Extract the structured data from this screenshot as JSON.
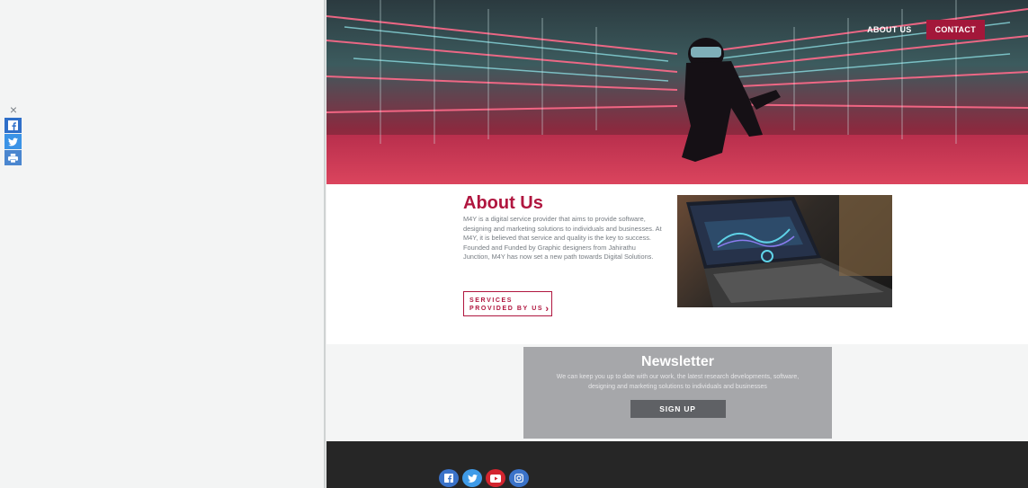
{
  "share_bar": {
    "close_glyph": "×",
    "icons": [
      "facebook-icon",
      "twitter-icon",
      "print-icon"
    ]
  },
  "nav": {
    "about_label": "ABOUT US",
    "contact_label": "CONTACT"
  },
  "about": {
    "title": "About Us",
    "text": "M4Y is a digital service provider that aims to provide software, designing and marketing solutions to individuals and businesses. At M4Y, it is believed that service and quality is the key to success. Founded and Funded by Graphic designers from Jahirathu Junction, M4Y has now set a new path towards Digital Solutions.",
    "services_line1": "SERVICES",
    "services_line2": "PROVIDED BY US",
    "services_arrow": "›"
  },
  "newsletter": {
    "title": "Newsletter",
    "text": "We can keep you up to date with our work, the latest research developments, software, designing and marketing solutions to individuals and businesses",
    "signup_label": "SIGN UP"
  },
  "footer": {
    "social": [
      "facebook-icon",
      "twitter-icon",
      "youtube-icon",
      "instagram-icon"
    ]
  },
  "colors": {
    "brand_red": "#b0163f",
    "contact_bg": "#a3173a",
    "footer_bg": "#262626",
    "newsletter_bg": "#a6a7aa"
  }
}
